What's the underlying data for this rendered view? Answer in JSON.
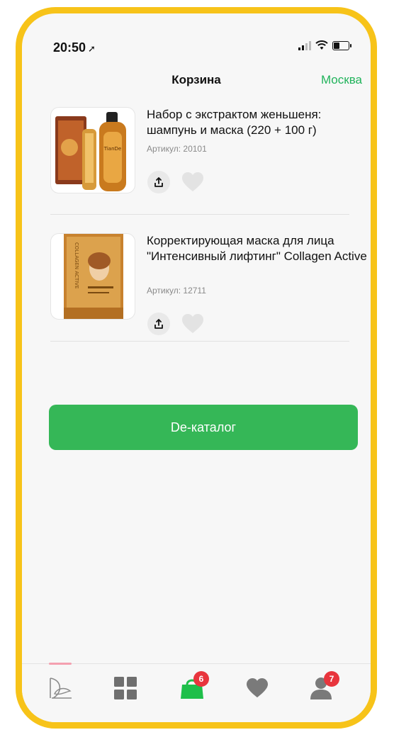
{
  "status_bar": {
    "time": "20:50",
    "location_arrow": "location-arrow-icon",
    "icons": [
      "cellular-signal-icon",
      "wifi-icon",
      "battery-icon"
    ]
  },
  "header": {
    "title": "Корзина",
    "city": "Москва"
  },
  "cart_items": [
    {
      "name": "Набор с экстрактом женьшеня: шампунь и маска (220 + 100 г)",
      "sku": "Артикул: 20101"
    },
    {
      "name": "Корректирующая маска для лица \"Интенсивный лифтинг\" Collagen Active",
      "sku": "Артикул: 12711"
    }
  ],
  "catalog_button": {
    "label": "De-каталог"
  },
  "tab_bar": {
    "cart_badge": "6",
    "profile_badge": "7",
    "icons": [
      "home-logo-icon",
      "catalog-grid-icon",
      "cart-bag-icon",
      "favorites-heart-icon",
      "profile-icon"
    ]
  },
  "colors": {
    "accent_green": "#35b757",
    "city_green": "#21b35b",
    "frame_yellow": "#f7c319",
    "badge_red": "#e8353d"
  }
}
